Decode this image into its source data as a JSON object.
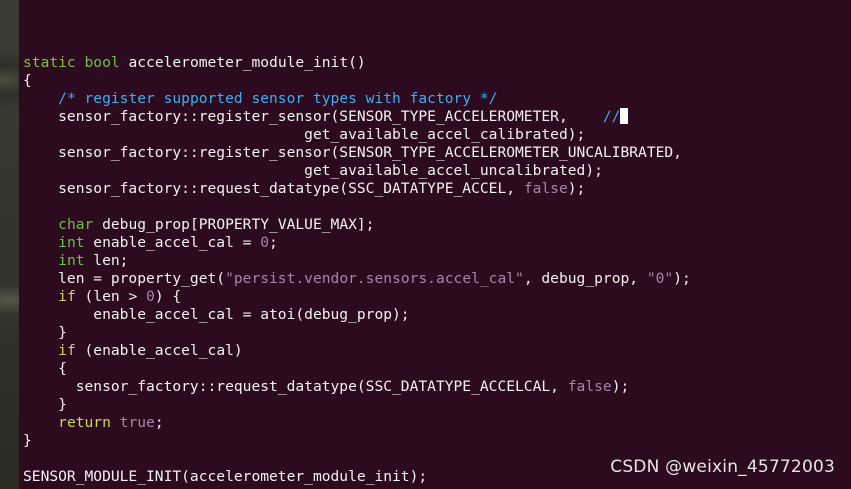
{
  "watermark": "CSDN @weixin_45772003",
  "colors": {
    "terminal_background": "#2c0a1f",
    "text": "#f2f2f2",
    "keyword": "#7fc22b",
    "comment": "#3ab0ee",
    "literal": "#a984a8"
  },
  "code_lines": [
    [],
    [
      {
        "t": "static",
        "c": "kw"
      },
      {
        "t": " "
      },
      {
        "t": "bool",
        "c": "typ"
      },
      {
        "t": " accelerometer_module_init()"
      }
    ],
    [
      {
        "t": "{"
      }
    ],
    [
      {
        "t": "    "
      },
      {
        "t": "/* register supported sensor types with factory */",
        "c": "cmt"
      }
    ],
    [
      {
        "t": "    sensor_factory::register_sensor(SENSOR_TYPE_ACCELEROMETER,    "
      },
      {
        "t": "//",
        "c": "cmt"
      },
      {
        "cursor": true
      }
    ],
    [
      {
        "t": "                                get_available_accel_calibrated);"
      }
    ],
    [
      {
        "t": "    sensor_factory::register_sensor(SENSOR_TYPE_ACCELEROMETER_UNCALIBRATED,"
      }
    ],
    [
      {
        "t": "                                get_available_accel_uncalibrated);"
      }
    ],
    [
      {
        "t": "    sensor_factory::request_datatype(SSC_DATATYPE_ACCEL, "
      },
      {
        "t": "false",
        "c": "lit"
      },
      {
        "t": ");"
      }
    ],
    [],
    [
      {
        "t": "    "
      },
      {
        "t": "char",
        "c": "typ"
      },
      {
        "t": " debug_prop[PROPERTY_VALUE_MAX];"
      }
    ],
    [
      {
        "t": "    "
      },
      {
        "t": "int",
        "c": "typ"
      },
      {
        "t": " enable_accel_cal = "
      },
      {
        "t": "0",
        "c": "lit"
      },
      {
        "t": ";"
      }
    ],
    [
      {
        "t": "    "
      },
      {
        "t": "int",
        "c": "typ"
      },
      {
        "t": " len;"
      }
    ],
    [
      {
        "t": "    len = property_get("
      },
      {
        "t": "\"persist.vendor.sensors.accel_cal\"",
        "c": "lit"
      },
      {
        "t": ", debug_prop, "
      },
      {
        "t": "\"0\"",
        "c": "lit"
      },
      {
        "t": ");"
      }
    ],
    [
      {
        "t": "    "
      },
      {
        "t": "if",
        "c": "ctl"
      },
      {
        "t": " (len > "
      },
      {
        "t": "0",
        "c": "lit"
      },
      {
        "t": ") {"
      }
    ],
    [
      {
        "t": "        enable_accel_cal = atoi(debug_prop);"
      }
    ],
    [
      {
        "t": "    }"
      }
    ],
    [
      {
        "t": "    "
      },
      {
        "t": "if",
        "c": "ctl"
      },
      {
        "t": " (enable_accel_cal)"
      }
    ],
    [
      {
        "t": "    {"
      }
    ],
    [
      {
        "t": "      sensor_factory::request_datatype(SSC_DATATYPE_ACCELCAL, "
      },
      {
        "t": "false",
        "c": "lit"
      },
      {
        "t": ");"
      }
    ],
    [
      {
        "t": "    }"
      }
    ],
    [
      {
        "t": "    "
      },
      {
        "t": "return",
        "c": "ctl"
      },
      {
        "t": " "
      },
      {
        "t": "true",
        "c": "lit"
      },
      {
        "t": ";"
      }
    ],
    [
      {
        "t": "}"
      }
    ],
    [],
    [
      {
        "t": "SENSOR_MODULE_INIT(accelerometer_module_init);"
      }
    ],
    [
      {
        "t": "~",
        "c": "tilde"
      }
    ]
  ]
}
